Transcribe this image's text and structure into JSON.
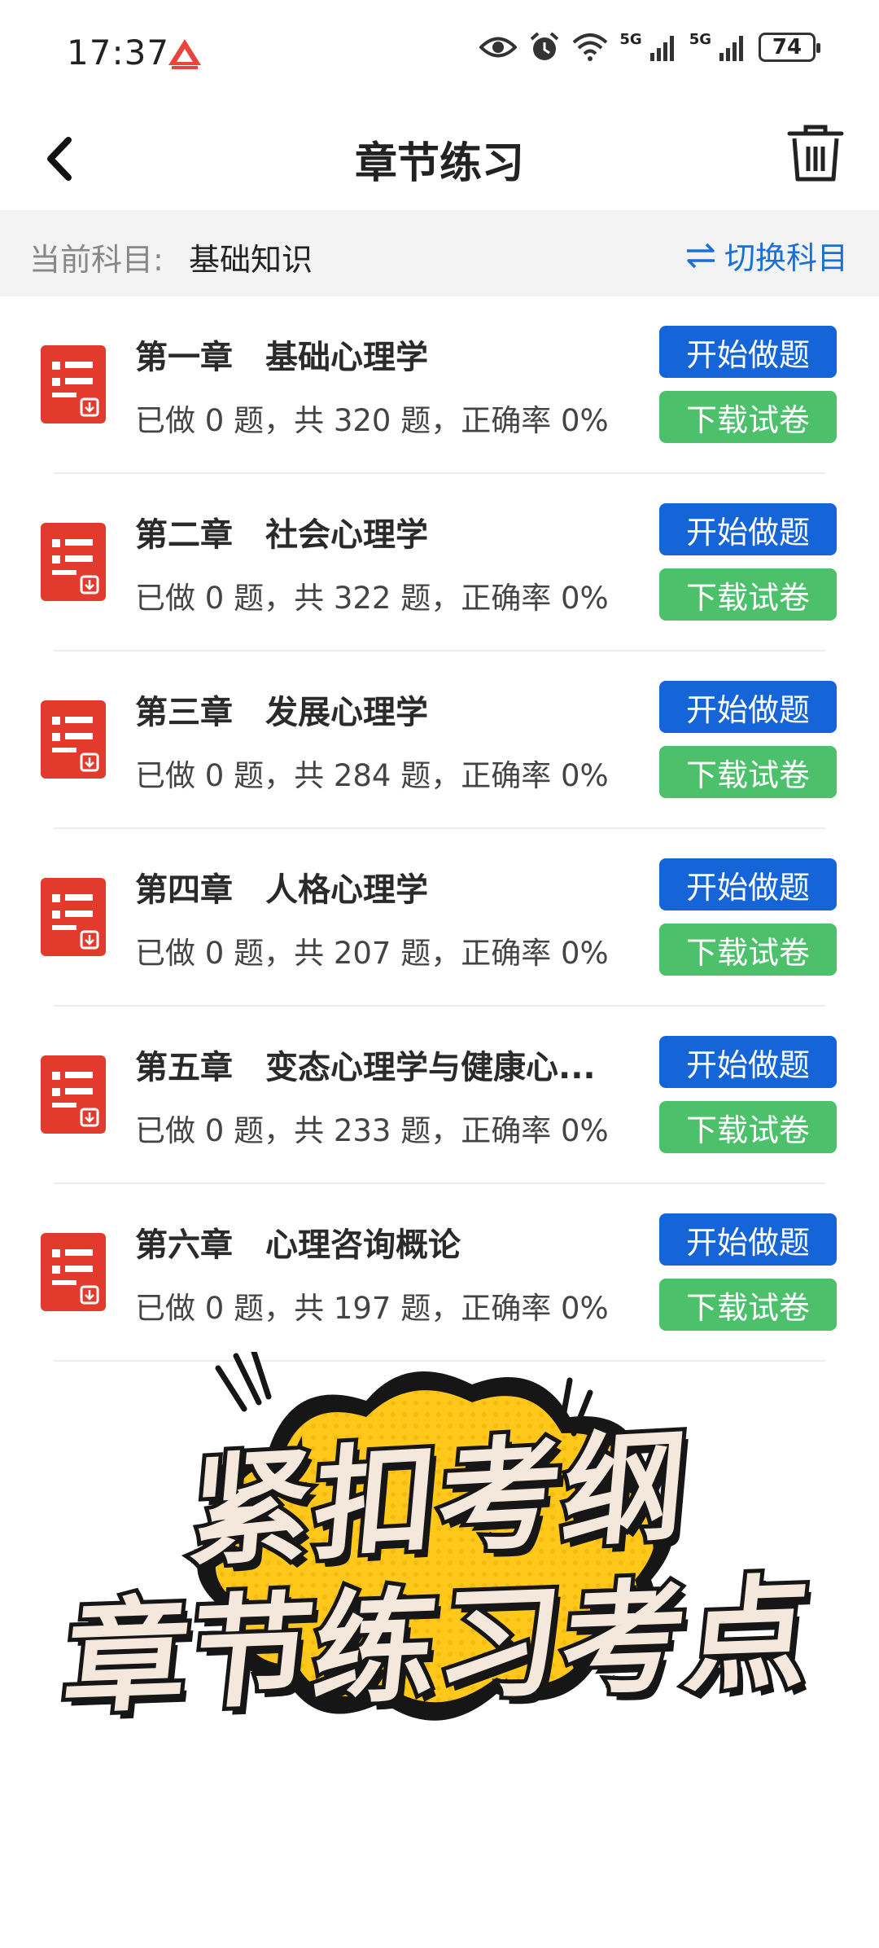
{
  "status_bar": {
    "time": "17:37",
    "network_1": "5G",
    "network_2": "5G",
    "battery": "74"
  },
  "header": {
    "title": "章节练习",
    "back_icon": "chevron-left-icon",
    "delete_icon": "trash-icon"
  },
  "subject": {
    "label": "当前科目:",
    "value": "基础知识",
    "switch_label": "切换科目",
    "switch_icon": "swap-icon",
    "accent_color": "#1a6fd6"
  },
  "chapters": [
    {
      "title": "第一章　基础心理学",
      "stats": "已做 0 题，共 320 题，正确率 0%",
      "start": "开始做题",
      "download": "下载试卷"
    },
    {
      "title": "第二章　社会心理学",
      "stats": "已做 0 题，共 322 题，正确率 0%",
      "start": "开始做题",
      "download": "下载试卷"
    },
    {
      "title": "第三章　发展心理学",
      "stats": "已做 0 题，共 284 题，正确率 0%",
      "start": "开始做题",
      "download": "下载试卷"
    },
    {
      "title": "第四章　人格心理学",
      "stats": "已做 0 题，共 207 题，正确率 0%",
      "start": "开始做题",
      "download": "下载试卷"
    },
    {
      "title": "第五章　变态心理学与健康心...",
      "stats": "已做 0 题，共 233 题，正确率 0%",
      "start": "开始做题",
      "download": "下载试卷"
    },
    {
      "title": "第六章　心理咨询概论",
      "stats": "已做 0 题，共 197 题，正确率 0%",
      "start": "开始做题",
      "download": "下载试卷"
    }
  ],
  "colors": {
    "start_button": "#1565d8",
    "download_button": "#4cc06b",
    "doc_icon": "#e23b2e"
  },
  "promo": {
    "line1": "紧扣考纲",
    "line2": "章节练习考点"
  }
}
